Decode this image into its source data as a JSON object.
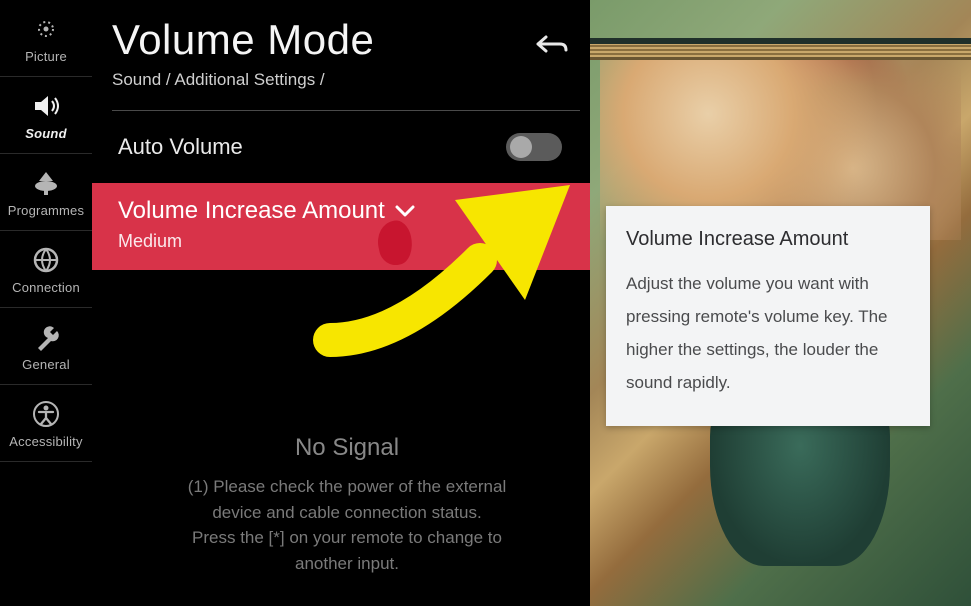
{
  "sidebar": {
    "items": [
      {
        "label": "Picture"
      },
      {
        "label": "Sound"
      },
      {
        "label": "Programmes"
      },
      {
        "label": "Connection"
      },
      {
        "label": "General"
      },
      {
        "label": "Accessibility"
      }
    ]
  },
  "panel": {
    "title": "Volume Mode",
    "breadcrumb": "Sound / Additional Settings /",
    "auto_volume_label": "Auto Volume",
    "auto_volume_on": false,
    "selected": {
      "title": "Volume Increase Amount",
      "value": "Medium"
    },
    "background_text": {
      "header": "No Signal",
      "line1": "(1) Please check the power of the external",
      "line2": "device and cable connection status.",
      "line3": "Press the [*] on your remote to change to",
      "line4": "another input."
    }
  },
  "help": {
    "title": "Volume Increase Amount",
    "body": "Adjust the volume you want with pressing remote's volume key. The higher the settings, the louder the sound rapidly."
  }
}
